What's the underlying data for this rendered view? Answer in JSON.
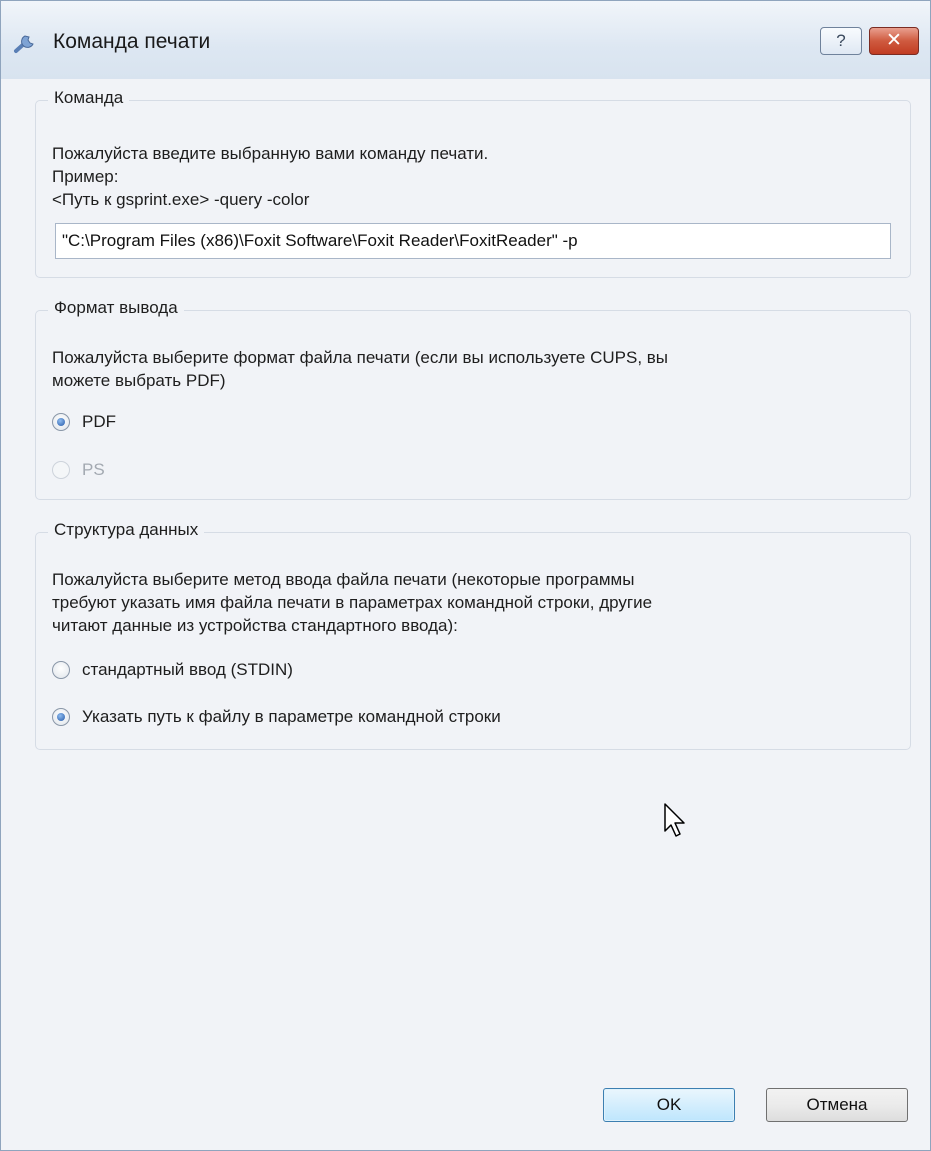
{
  "window": {
    "title": "Команда печати",
    "help_label": "?",
    "close_label": "✕"
  },
  "command_group": {
    "title": "Команда",
    "description": "Пожалуйста введите выбранную вами команду печати.",
    "example_label": "Пример:",
    "example_value": "<Путь к gsprint.exe> -query -color",
    "input_value": "\"C:\\Program Files (x86)\\Foxit Software\\Foxit Reader\\FoxitReader\" -p "
  },
  "format_group": {
    "title": "Формат вывода",
    "description_line1": "Пожалуйста выберите формат файла печати (если вы используете CUPS, вы",
    "description_line2": "можете выбрать PDF)",
    "options": [
      {
        "label": "PDF",
        "checked": true,
        "enabled": true
      },
      {
        "label": "PS",
        "checked": false,
        "enabled": false
      }
    ]
  },
  "data_group": {
    "title": "Структура данных",
    "description_line1": "Пожалуйста выберите метод ввода файла печати (некоторые программы",
    "description_line2": "требуют указать имя файла печати в параметрах командной строки, другие",
    "description_line3": "читают данные из устройства стандартного ввода):",
    "options": [
      {
        "label": "стандартный ввод (STDIN)",
        "checked": false,
        "enabled": true
      },
      {
        "label": "Указать путь к файлу в параметре командной строки",
        "checked": true,
        "enabled": true
      }
    ]
  },
  "buttons": {
    "ok": "OK",
    "cancel": "Отмена"
  },
  "colors": {
    "title_bar": "#dde7f2",
    "close_button": "#c13c22",
    "dialog_background": "#f1f3f7",
    "ok_button": "#bee6fd"
  },
  "icons": {
    "title": "wrench-icon",
    "cursor": "mouse-pointer-icon"
  }
}
